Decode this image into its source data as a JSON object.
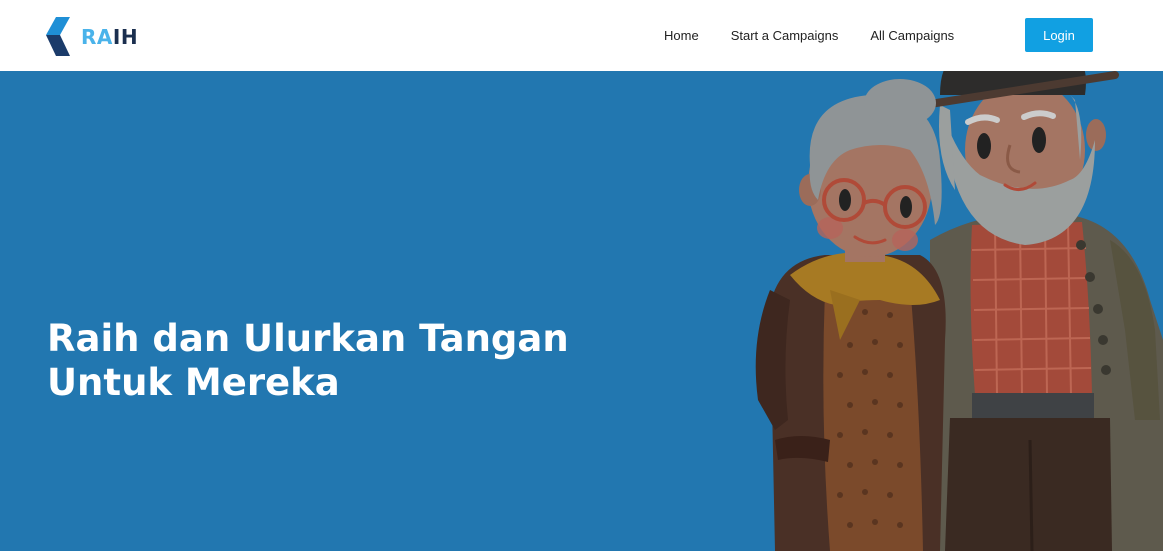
{
  "header": {
    "logo": {
      "text_a": "RA",
      "text_b": "IH",
      "icon": "raih-logo-icon",
      "color_light": "#4ab3ea",
      "color_dark": "#1b2f4f"
    },
    "nav": [
      {
        "label": "Home"
      },
      {
        "label": "Start a Campaigns"
      },
      {
        "label": "All Campaigns"
      }
    ],
    "login_label": "Login"
  },
  "hero": {
    "title_line1": "Raih dan Ulurkan Tangan",
    "title_line2": "Untuk Mereka",
    "illustration": "elderly-couple-illustration",
    "background": "#2277b0"
  },
  "colors": {
    "accent": "#11a0e2",
    "hero_bg": "#2277b0"
  }
}
